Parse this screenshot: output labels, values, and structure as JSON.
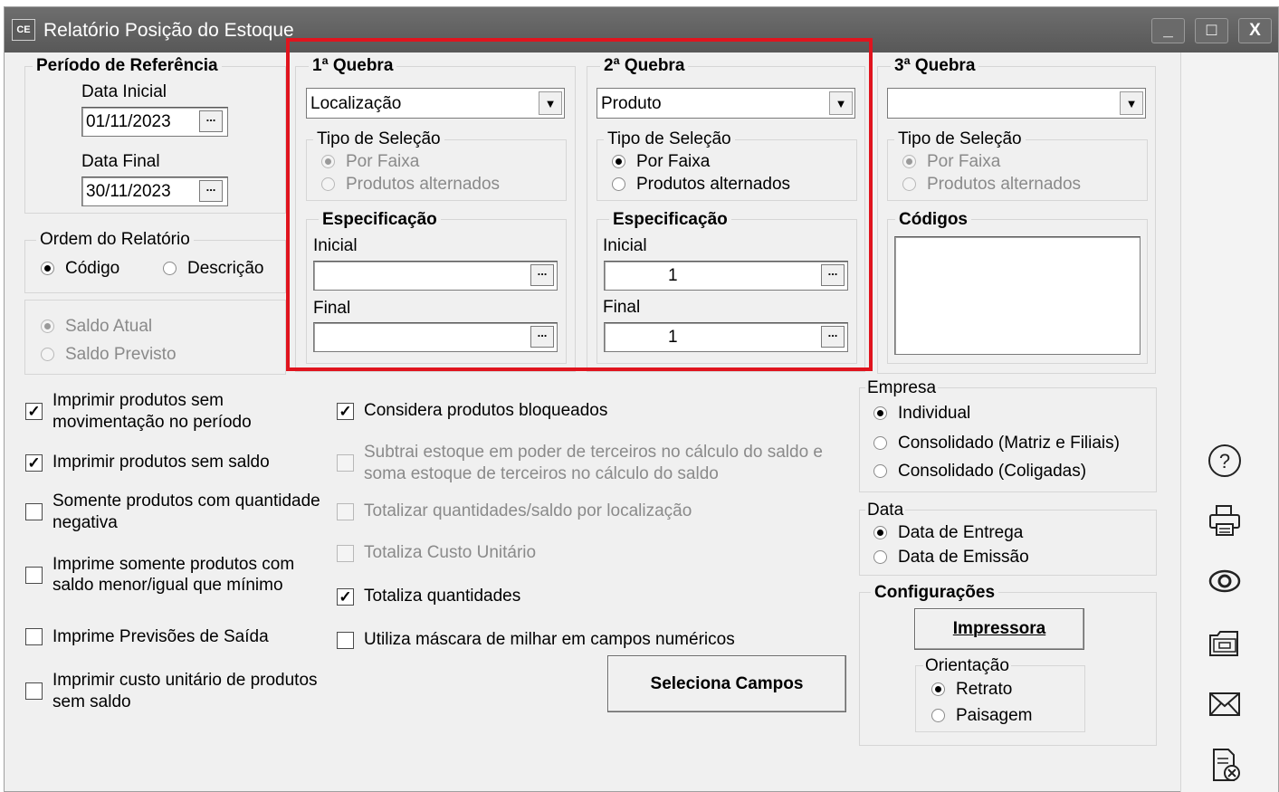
{
  "window": {
    "app_icon": "CE",
    "title": "Relatório Posição do Estoque",
    "min_label": "_",
    "max_label": "□",
    "close_label": "X"
  },
  "periodo": {
    "legend": "Período de Referência",
    "data_inicial_label": "Data Inicial",
    "data_inicial": "01/11/2023",
    "data_final_label": "Data Final",
    "data_final": "30/11/2023",
    "dots": "..."
  },
  "ordem": {
    "legend": "Ordem do Relatório",
    "codigo": "Código",
    "descricao": "Descrição"
  },
  "saldo": {
    "atual": "Saldo Atual",
    "previsto": "Saldo Previsto"
  },
  "quebra1": {
    "legend": "1ª Quebra",
    "combo": "Localização",
    "tipo_legend": "Tipo de Seleção",
    "por_faixa": "Por Faixa",
    "alternados": "Produtos alternados",
    "espec_legend": "Especificação",
    "inicial_label": "Inicial",
    "inicial": "",
    "final_label": "Final",
    "final": ""
  },
  "quebra2": {
    "legend": "2ª Quebra",
    "combo": "Produto",
    "tipo_legend": "Tipo de Seleção",
    "por_faixa": "Por Faixa",
    "alternados": "Produtos alternados",
    "espec_legend": "Especificação",
    "inicial_label": "Inicial",
    "inicial": "1",
    "final_label": "Final",
    "final": "1"
  },
  "quebra3": {
    "legend": "3ª Quebra",
    "combo": "",
    "tipo_legend": "Tipo de Seleção",
    "por_faixa": "Por Faixa",
    "alternados": "Produtos alternados",
    "codigos_legend": "Códigos"
  },
  "options_left": [
    {
      "line1": "Imprimir produtos sem",
      "line2": "movimentação no período",
      "checked": true
    },
    {
      "line1": "Imprimir produtos sem saldo",
      "line2": "",
      "checked": true
    },
    {
      "line1": "Somente produtos com quantidade",
      "line2": "negativa",
      "checked": false
    },
    {
      "line1": "Imprime somente produtos com",
      "line2": "saldo menor/igual que mínimo",
      "checked": false
    },
    {
      "line1": "Imprime Previsões de Saída",
      "line2": "",
      "checked": false
    },
    {
      "line1": "Imprimir custo unitário de produtos",
      "line2": "sem saldo",
      "checked": false
    }
  ],
  "options_mid": [
    {
      "line1": "Considera produtos bloqueados",
      "line2": "",
      "checked": true,
      "enabled": true
    },
    {
      "line1": "Subtrai estoque em poder de terceiros no cálculo do saldo e",
      "line2": "soma estoque de terceiros no cálculo do saldo",
      "checked": false,
      "enabled": false
    },
    {
      "line1": "Totalizar quantidades/saldo por localização",
      "line2": "",
      "checked": false,
      "enabled": false
    },
    {
      "line1": "Totaliza Custo Unitário",
      "line2": "",
      "checked": false,
      "enabled": false
    },
    {
      "line1": "Totaliza quantidades",
      "line2": "",
      "checked": true,
      "enabled": true
    },
    {
      "line1": "Utiliza máscara de milhar em campos numéricos",
      "line2": "",
      "checked": false,
      "enabled": true
    }
  ],
  "check_mark": "✓",
  "seleciona_campos": "Seleciona Campos",
  "empresa": {
    "legend": "Empresa",
    "individual": "Individual",
    "matriz": "Consolidado (Matriz e Filiais)",
    "coligadas": "Consolidado (Coligadas)"
  },
  "data": {
    "legend": "Data",
    "entrega": "Data de Entrega",
    "emissao": "Data de Emissão"
  },
  "config": {
    "legend": "Configurações",
    "impressora": "Impressora",
    "orientacao_legend": "Orientação",
    "retrato": "Retrato",
    "paisagem": "Paisagem"
  },
  "colors": {
    "highlight": "#e0141e",
    "titlebar": "#5f5f5f"
  }
}
